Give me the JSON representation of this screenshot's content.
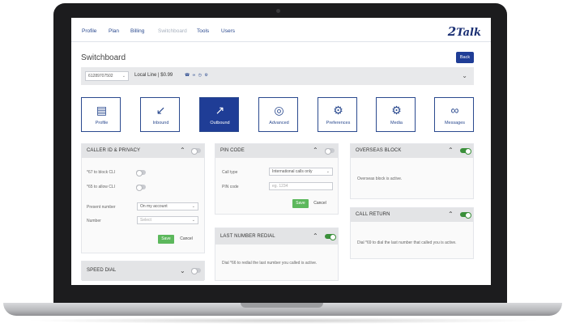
{
  "nav": {
    "items": [
      "Profile",
      "Plan",
      "Billing",
      "Switchboard",
      "Tools",
      "Users"
    ],
    "active": "Switchboard",
    "logo": {
      "prefix": "2",
      "word": "Talk"
    }
  },
  "page": {
    "title": "Switchboard",
    "back_label": "Back"
  },
  "line_bar": {
    "number": "61289707502",
    "info": "Local Line  |  $0.99",
    "icons": [
      "phone-icon",
      "video-icon",
      "voicemail-icon",
      "clock-icon",
      "gear-icon"
    ]
  },
  "features": [
    {
      "label": "Profile",
      "icon": "profile-card-icon",
      "glyph": "▤"
    },
    {
      "label": "Inbound",
      "icon": "inbound-call-icon",
      "glyph": "↙"
    },
    {
      "label": "Outbound",
      "icon": "outbound-call-icon",
      "glyph": "↗"
    },
    {
      "label": "Advanced",
      "icon": "advanced-target-icon",
      "glyph": "◎"
    },
    {
      "label": "Preferences",
      "icon": "preferences-gear-icon",
      "glyph": "⚙"
    },
    {
      "label": "Media",
      "icon": "media-gear-icon",
      "glyph": "⚙"
    },
    {
      "label": "Messages",
      "icon": "voicemail-icon",
      "glyph": "∞"
    }
  ],
  "active_feature": "Outbound",
  "caller_id": {
    "title": "CALLER ID & PRIVACY",
    "block_text": "*67 to block CLI",
    "allow_text": "*65 to allow CLI",
    "present_label": "Present number",
    "present_value": "On my account",
    "number_label": "Number",
    "number_placeholder": "Select",
    "save": "Save",
    "cancel": "Cancel",
    "enabled": false
  },
  "pin_code": {
    "title": "PIN CODE",
    "call_type_label": "Call type",
    "call_type_value": "International calls only",
    "pin_label": "PIN code",
    "pin_placeholder": "eg. 1234",
    "save": "Save",
    "cancel": "Cancel",
    "enabled": false
  },
  "last_number_redial": {
    "title": "LAST NUMBER REDIAL",
    "text": "Dial *66 to redial the last number you called is active.",
    "enabled": true
  },
  "overseas_block": {
    "title": "OVERSEAS BLOCK",
    "text": "Overseas block is active.",
    "enabled": true
  },
  "call_return": {
    "title": "CALL RETURN",
    "text": "Dial *69 to dial the last number that called you is active.",
    "enabled": true
  },
  "speed_dial": {
    "title": "SPEED DIAL",
    "enabled": false
  },
  "colors": {
    "brand": "#1f3d96",
    "toggle_on": "#3a8f3a",
    "save": "#5cb85c"
  }
}
